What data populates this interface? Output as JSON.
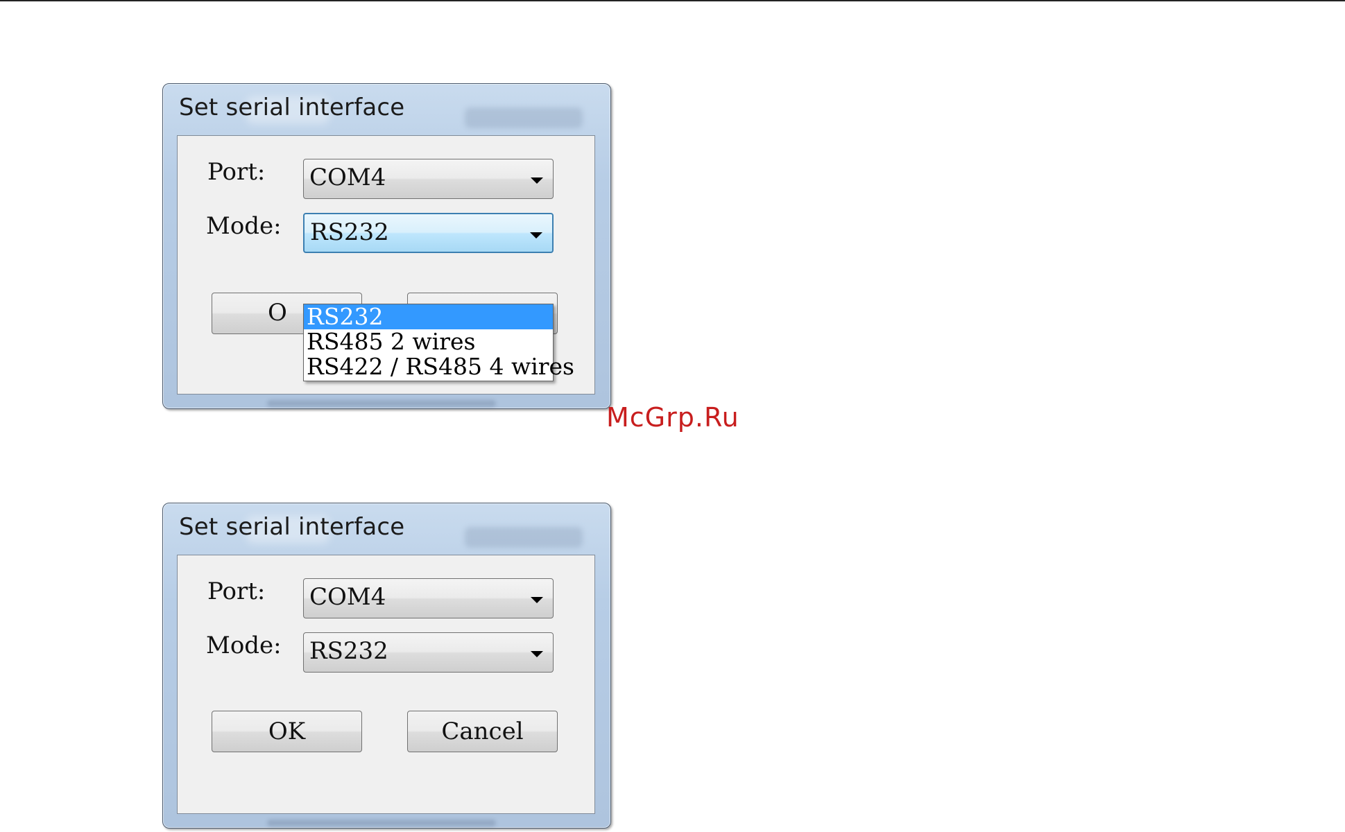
{
  "watermark": "McGrp.Ru",
  "dialog_open": {
    "title": "Set serial interface",
    "port_label": "Port:",
    "port_value": "COM4",
    "mode_label": "Mode:",
    "mode_value": "RS232",
    "ok_partial": "O",
    "options": [
      "RS232",
      "RS485 2 wires",
      "RS422 / RS485 4 wires"
    ]
  },
  "dialog_closed": {
    "title": "Set serial interface",
    "port_label": "Port:",
    "port_value": "COM4",
    "mode_label": "Mode:",
    "mode_value": "RS232",
    "ok_label": "OK",
    "cancel_label": "Cancel"
  },
  "colors": {
    "selection": "#3399ff",
    "watermark": "#c81e1e",
    "dialog_frame": "#b7cde6"
  }
}
